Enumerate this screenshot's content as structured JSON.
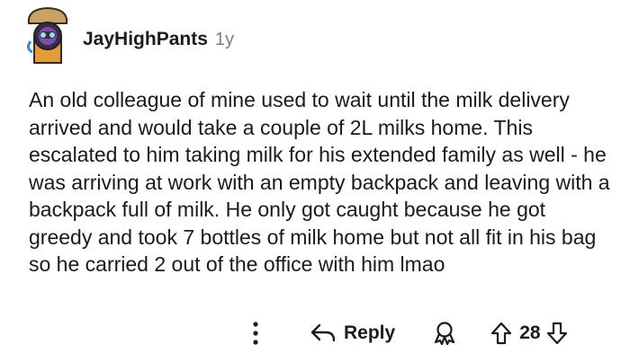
{
  "comment": {
    "username": "JayHighPants",
    "timestamp": "1y",
    "body": "An old colleague of mine used to wait until the milk delivery arrived and would take a couple of 2L milks home. This escalated to him taking milk for his extended family as well - he was arriving at work with an empty backpack and leaving with a backpack full of milk. He only got caught because he got greedy and took 7 bottles of milk home but not all fit in his bag so he carried 2 out of the office with him lmao",
    "vote_score": "28"
  },
  "actions": {
    "reply_label": "Reply"
  },
  "icons": {
    "more": "more-options-icon",
    "reply": "reply-arrow-icon",
    "award": "award-icon",
    "upvote": "upvote-arrow-icon",
    "downvote": "downvote-arrow-icon"
  }
}
